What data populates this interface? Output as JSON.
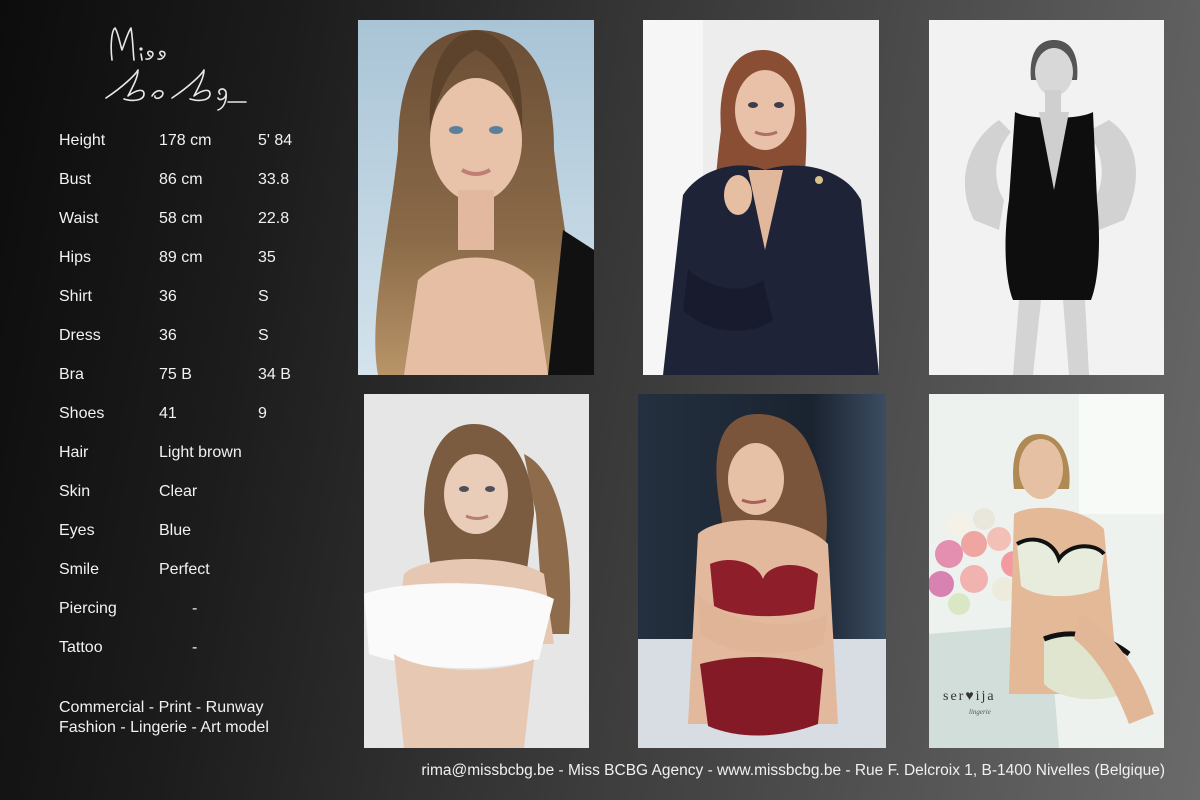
{
  "brand": {
    "logo_text": "Miss BcBg"
  },
  "measurements": [
    {
      "label": "Height",
      "metric": "178 cm",
      "imperial": "5' 84"
    },
    {
      "label": "Bust",
      "metric": "86 cm",
      "imperial": "33.8"
    },
    {
      "label": "Waist",
      "metric": "58 cm",
      "imperial": "22.8"
    },
    {
      "label": "Hips",
      "metric": "89 cm",
      "imperial": "35"
    },
    {
      "label": "Shirt",
      "metric": "36",
      "imperial": "S"
    },
    {
      "label": "Dress",
      "metric": "36",
      "imperial": "S"
    },
    {
      "label": "Bra",
      "metric": "75 B",
      "imperial": "34 B"
    },
    {
      "label": "Shoes",
      "metric": "41",
      "imperial": "9"
    },
    {
      "label": "Hair",
      "metric": "Light brown",
      "imperial": ""
    },
    {
      "label": "Skin",
      "metric": "Clear",
      "imperial": ""
    },
    {
      "label": "Eyes",
      "metric": "Blue",
      "imperial": ""
    },
    {
      "label": "Smile",
      "metric": "Perfect",
      "imperial": ""
    },
    {
      "label": "Piercing",
      "dash": "-"
    },
    {
      "label": "Tattoo",
      "dash": "-"
    }
  ],
  "categories": {
    "line1": "Commercial - Print - Runway",
    "line2": "Fashion - Lingerie - Art model"
  },
  "photos": {
    "watermark": "ser♥ija",
    "watermark_sub": "lingerie"
  },
  "footer": {
    "contact": "rima@missbcbg.be - Miss BCBG Agency - www.missbcbg.be - Rue F. Delcroix 1, B-1400 Nivelles (Belgique)"
  }
}
